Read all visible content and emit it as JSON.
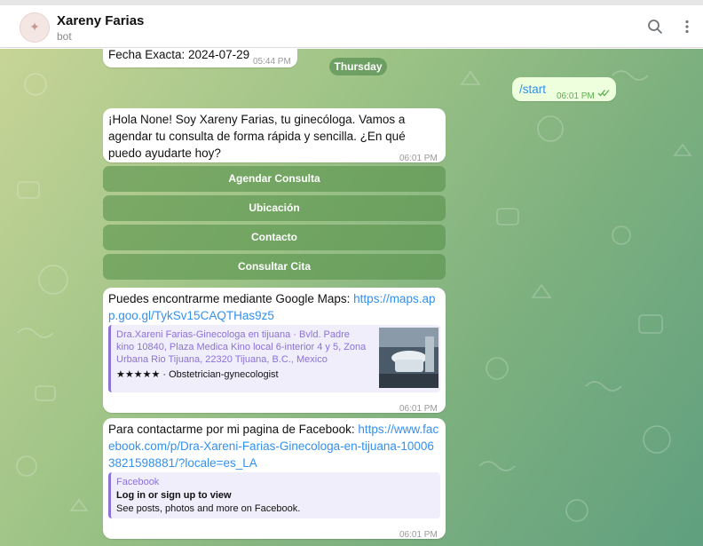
{
  "header": {
    "title": "Xareny Farias",
    "subtitle": "bot",
    "avatar_glyph": "✦",
    "search_icon": "search-icon",
    "menu_icon": "more-vertical-icon"
  },
  "chat": {
    "day_separator": "Thursday",
    "prev_message": {
      "text": "Fecha Exacta: 2024-07-29",
      "time": "05:44 PM"
    },
    "outgoing": {
      "text": "/start",
      "time": "06:01 PM",
      "status_icon": "double-check-icon"
    },
    "greeting": {
      "text": "¡Hola None!  Soy Xareny Farias, tu ginecóloga. Vamos a agendar tu consulta de forma rápida y sencilla. ¿En qué puedo ayudarte hoy?",
      "time": "06:01 PM"
    },
    "keyboard": [
      "Agendar Consulta",
      "Ubicación",
      "Contacto",
      "Consultar Cita"
    ],
    "maps_message": {
      "text": "Puedes encontrarme mediante Google Maps: ",
      "link": "https://maps.app.goo.gl/TykSv15CAQTHas9z5",
      "preview_site": "Dra.Xareni Farias-Ginecologa en tijuana · Bvld. Padre kino 10840, Plaza Medica Kino local 6-interior 4 y 5, Zona Urbana Rio Tijuana, 22320 Tijuana, B.C., Mexico",
      "preview_rating": "★★★★★ · Obstetrician-gynecologist",
      "time": "06:01 PM"
    },
    "facebook_message": {
      "text": "Para contactarme por mi pagina de Facebook: ",
      "link": "https://www.facebook.com/p/Dra-Xareni-Farias-Ginecologa-en-tijuana-100063821598881/?locale=es_LA",
      "preview_site": "Facebook",
      "preview_title": "Log in or sign up to view",
      "preview_text": "See posts, photos and more on Facebook.",
      "time": "06:01 PM"
    }
  },
  "colors": {
    "link": "#3390ec",
    "outgoing_bubble": "#eeffde",
    "preview_accent": "#8b72d6"
  }
}
